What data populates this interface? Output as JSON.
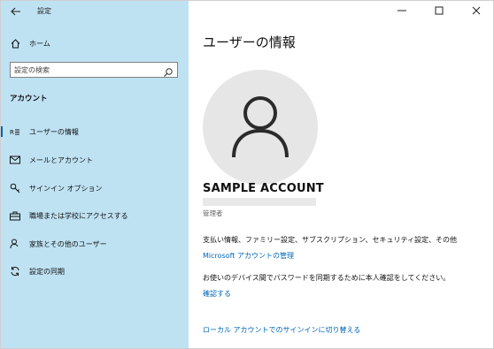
{
  "window": {
    "title": "設定"
  },
  "sidebar": {
    "home_label": "ホーム",
    "search_placeholder": "設定の検索",
    "section_heading": "アカウント",
    "items": [
      {
        "label": "ユーザーの情報",
        "icon": "person-card-icon",
        "active": true
      },
      {
        "label": "メールとアカウント",
        "icon": "mail-icon",
        "active": false
      },
      {
        "label": "サインイン オプション",
        "icon": "key-icon",
        "active": false
      },
      {
        "label": "職場または学校にアクセスする",
        "icon": "briefcase-icon",
        "active": false
      },
      {
        "label": "家族とその他のユーザー",
        "icon": "person-add-icon",
        "active": false
      },
      {
        "label": "設定の同期",
        "icon": "sync-icon",
        "active": false
      }
    ]
  },
  "main": {
    "page_title": "ユーザーの情報",
    "account_name": "SAMPLE ACCOUNT",
    "role": "管理者",
    "info_text": "支払い情報、ファミリー設定、サブスクリプション、セキュリティ設定、その他",
    "manage_link": "Microsoft アカウントの管理",
    "sync_text": "お使いのデバイス間でパスワードを同期するために本人確認をしてください。",
    "verify_link": "確認する",
    "local_signin_link": "ローカル アカウントでのサインインに切り替える"
  },
  "colors": {
    "sidebar_bg": "#bfe2f3",
    "accent": "#0067b8",
    "avatar_bg": "#e6e6e6"
  }
}
